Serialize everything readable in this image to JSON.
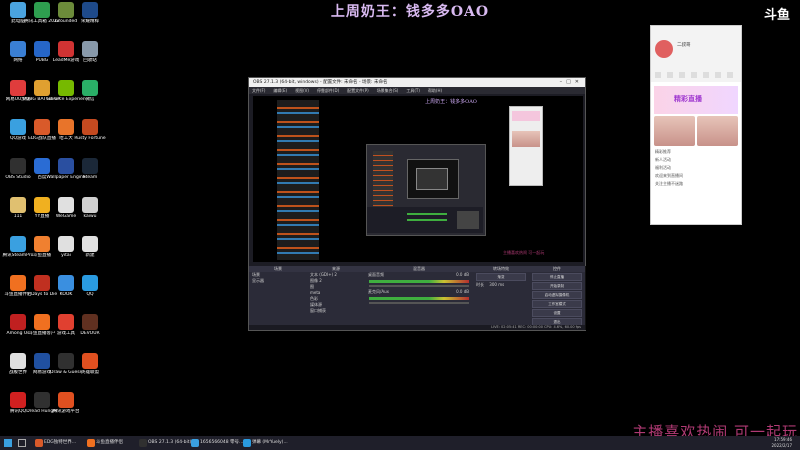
{
  "overlay": {
    "title": "上周奶王：钱多多OAO",
    "logo": "斗鱼",
    "bottom_text": "主播喜欢热闹 可一起玩"
  },
  "desktop_icons": [
    {
      "label": "此电脑",
      "color": "#4aa3df"
    },
    {
      "label": "腾讯工具箱 2022",
      "color": "#2e9e4f"
    },
    {
      "label": "Grounded",
      "color": "#6c8b3a"
    },
    {
      "label": "荣耀精粹",
      "color": "#1e4a8a"
    },
    {
      "label": "网络",
      "color": "#3a7fd4"
    },
    {
      "label": "PUBG",
      "color": "#2666c8"
    },
    {
      "label": "LeadMe游戏",
      "color": "#d03333"
    },
    {
      "label": "回收站",
      "color": "#8899aa"
    },
    {
      "label": "网易UU加速",
      "color": "#e03c3c"
    },
    {
      "label": "PUBG BATTLEGR",
      "color": "#e0a030"
    },
    {
      "label": "GeForce Experience",
      "color": "#76b900"
    },
    {
      "label": "微信",
      "color": "#2aae67"
    },
    {
      "label": "QQ游戏",
      "color": "#3aa0e0"
    },
    {
      "label": "EDG战队直播",
      "color": "#d95a2a"
    },
    {
      "label": "哈工大",
      "color": "#e8742a"
    },
    {
      "label": "Rusty Fortune",
      "color": "#c44a20"
    },
    {
      "label": "OBS Studio",
      "color": "#303030"
    },
    {
      "label": "百度",
      "color": "#2a6cd4"
    },
    {
      "label": "Wallpaper Engine",
      "color": "#2a4fa0"
    },
    {
      "label": "Steam",
      "color": "#1b2838"
    },
    {
      "label": "111",
      "color": "#e0c070"
    },
    {
      "label": "YY直播",
      "color": "#f0b020"
    },
    {
      "label": "WeGame",
      "color": "#e0e0e0"
    },
    {
      "label": "kaiwu",
      "color": "#d0d0d0"
    },
    {
      "label": "腾讯SteamPro",
      "color": "#3aa0e0"
    },
    {
      "label": "斗鱼直播",
      "color": "#f08030"
    },
    {
      "label": "yitai",
      "color": "#e0e0e0"
    },
    {
      "label": "新建",
      "color": "#e0e0e0"
    },
    {
      "label": "斗鱼直播伴侣",
      "color": "#f07020"
    },
    {
      "label": "7 Days to Die",
      "color": "#c03020"
    },
    {
      "label": "KOOK",
      "color": "#3a8fe0"
    },
    {
      "label": "QQ",
      "color": "#2a9be0"
    },
    {
      "label": "Among Us",
      "color": "#c02020"
    },
    {
      "label": "斗鱼直播客户",
      "color": "#f07020"
    },
    {
      "label": "游戏工具",
      "color": "#e04030"
    },
    {
      "label": "DEVOUR",
      "color": "#603020"
    },
    {
      "label": "战舰世界",
      "color": "#e0e0e0"
    },
    {
      "label": "网易游戏",
      "color": "#2050a0"
    },
    {
      "label": "Draw & Guess",
      "color": "#303030"
    },
    {
      "label": "英雄联盟",
      "color": "#e05020"
    },
    {
      "label": "腾讯QQ",
      "color": "#d02020"
    },
    {
      "label": "Dread Hunger",
      "color": "#303030"
    },
    {
      "label": "腾讯游戏平台",
      "color": "#e05020"
    }
  ],
  "obs": {
    "window_title": "OBS 27.1.3 (64-bit, windows) - 配置文件: 未命名 - 场景: 未命名",
    "menu": [
      "文件(F)",
      "编辑(E)",
      "视图(V)",
      "停靠部件(D)",
      "配置文件(P)",
      "场景集合(S)",
      "工具(T)",
      "帮助(H)"
    ],
    "inner_title": "上周奶王：钱多多OAO",
    "docks": {
      "scenes_header": "场景",
      "scenes": [
        "场景",
        "显示器"
      ],
      "sources_header": "来源",
      "sources": [
        "文本 (GDI+) 2",
        "图像 2",
        "图",
        "meta",
        "色彩",
        "媒体源",
        "窗口捕获"
      ],
      "mixer_header": "混音器",
      "mixer": [
        {
          "label": "桌面音频",
          "value": "0.0 dB"
        },
        {
          "label": "麦克风/Aux",
          "value": "0.0 dB"
        }
      ],
      "transitions_header": "转场特效",
      "transition_value": "渐变",
      "duration_label": "时长",
      "duration_value": "300 ms",
      "controls_header": "控件",
      "controls": [
        "停止直播",
        "开始录制",
        "启动虚拟摄像机",
        "工作室模式",
        "设置",
        "退出"
      ]
    },
    "status": "LIVE: 02:05:41   REC: 00:00:00   CPU: 4.6%, 60.00 fps"
  },
  "chat": {
    "streamer": "二叔哥",
    "banner_text": "精彩直播",
    "messages": [
      "精彩推荐",
      "新人活动",
      "福利活动",
      "欢迎来到直播间",
      "关注主播不迷路"
    ]
  },
  "taskbar": {
    "items": [
      {
        "label": "EDG独特世界...",
        "color": "#d95a2a"
      },
      {
        "label": "斗鱼直播伴侣",
        "color": "#f07020"
      },
      {
        "label": "OBS 27.1.3 (64-bit)...",
        "color": "#303030"
      },
      {
        "label": "1656566048 零号...",
        "color": "#3aa0e0"
      },
      {
        "label": "弹幕 (MrYuely)...",
        "color": "#2a9be0"
      }
    ],
    "time": "17:59:46",
    "date": "2022/2/17"
  }
}
